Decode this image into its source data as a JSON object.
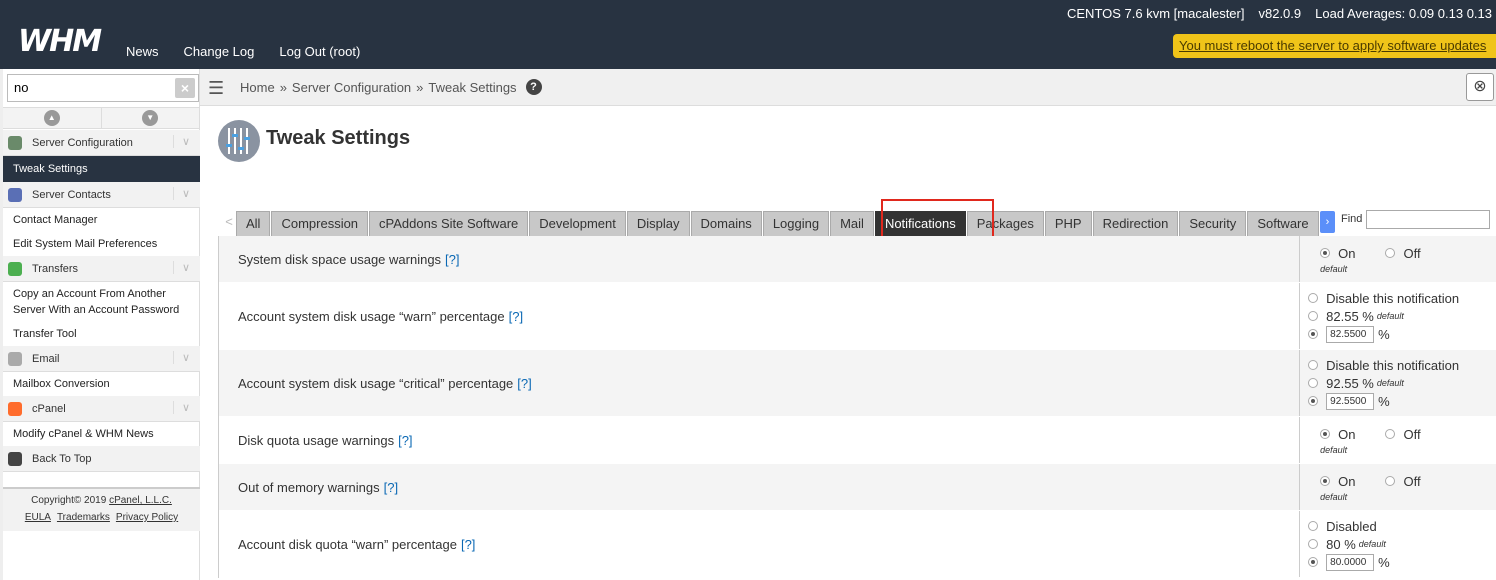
{
  "header": {
    "logo": "WHM",
    "nav": [
      "News",
      "Change Log",
      "Log Out (root)"
    ],
    "server": "CENTOS 7.6 kvm [macalester]",
    "version": "v82.0.9",
    "load": "Load Averages: 0.09 0.13 0.13",
    "reboot_notice": "You must reboot the server to apply software updates"
  },
  "sidebar": {
    "search_value": "no",
    "clear_icon": "×",
    "items": [
      {
        "type": "cat",
        "label": "Server Configuration",
        "icon_color": "#6a8a6a"
      },
      {
        "type": "item",
        "label": "Tweak Settings",
        "active": true
      },
      {
        "type": "cat",
        "label": "Server Contacts",
        "icon_color": "#5a6fb5"
      },
      {
        "type": "item",
        "label": "Contact Manager"
      },
      {
        "type": "item",
        "label": "Edit System Mail Preferences"
      },
      {
        "type": "cat",
        "label": "Transfers",
        "icon_color": "#4caf50"
      },
      {
        "type": "item",
        "label": "Copy an Account From Another Server With an Account Password"
      },
      {
        "type": "item",
        "label": "Transfer Tool"
      },
      {
        "type": "cat",
        "label": "Email",
        "icon_color": "#aaa"
      },
      {
        "type": "item",
        "label": "Mailbox Conversion"
      },
      {
        "type": "cat",
        "label": "cPanel",
        "icon_color": "#ff6c2c"
      },
      {
        "type": "item",
        "label": "Modify cPanel & WHM News"
      },
      {
        "type": "cat",
        "label": "Back To Top",
        "icon_color": "#444"
      }
    ],
    "footer": {
      "copyright": "Copyright© 2019",
      "company": "cPanel, L.L.C.",
      "links": [
        "EULA",
        "Trademarks",
        "Privacy Policy"
      ]
    }
  },
  "breadcrumb": {
    "home": "Home",
    "section": "Server Configuration",
    "page": "Tweak Settings",
    "sep": "»",
    "help": "?"
  },
  "page": {
    "title": "Tweak Settings"
  },
  "tabs": [
    "All",
    "Compression",
    "cPAddons Site Software",
    "Development",
    "Display",
    "Domains",
    "Logging",
    "Mail",
    "Notifications",
    "Packages",
    "PHP",
    "Redirection",
    "Security",
    "Software"
  ],
  "active_tab": "Notifications",
  "find_label": "Find",
  "help_link": "[?]",
  "settings": [
    {
      "label": "System disk space usage warnings",
      "kind": "onoff",
      "on": "On",
      "off": "Off",
      "default": "default"
    },
    {
      "label": "Account system disk usage “warn” percentage",
      "kind": "pct",
      "disable": "Disable this notification",
      "default_val": "82.55 %",
      "default": "default",
      "value": "82.5500",
      "unit": "%"
    },
    {
      "label": "Account system disk usage “critical” percentage",
      "kind": "pct",
      "disable": "Disable this notification",
      "default_val": "92.55 %",
      "default": "default",
      "value": "92.5500",
      "unit": "%"
    },
    {
      "label": "Disk quota usage warnings",
      "kind": "onoff",
      "on": "On",
      "off": "Off",
      "default": "default"
    },
    {
      "label": "Out of memory warnings",
      "kind": "onoff",
      "on": "On",
      "off": "Off",
      "default": "default"
    },
    {
      "label": "Account disk quota “warn” percentage",
      "kind": "pct",
      "disable": "Disabled",
      "default_val": "80 %",
      "default": "default",
      "value": "80.0000",
      "unit": "%"
    }
  ]
}
